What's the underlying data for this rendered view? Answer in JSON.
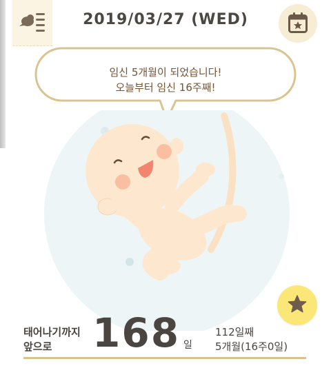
{
  "header": {
    "date": "2019/03/27 (WED)",
    "menu_icon": "bird-menu-icon",
    "calendar_icon": "calendar-star-icon"
  },
  "bubble": {
    "line1": "임신 5개월이 되었습니다!",
    "line2": "오늘부터 임신 16주째!"
  },
  "countdown": {
    "label_line1": "태어나기까지",
    "label_line2": "앞으로",
    "days_remaining": "168",
    "unit": "일",
    "day_count": "112일째",
    "month_week": "5개월(16주0일)"
  },
  "favorite_icon": "star-icon",
  "colors": {
    "accent_gold": "#d8c38e",
    "bubble_border": "#d9c48f",
    "star_button": "#fbe678",
    "calendar_button": "#f7ecd4",
    "text": "#4a4540",
    "bubble_text": "#7a5230"
  }
}
